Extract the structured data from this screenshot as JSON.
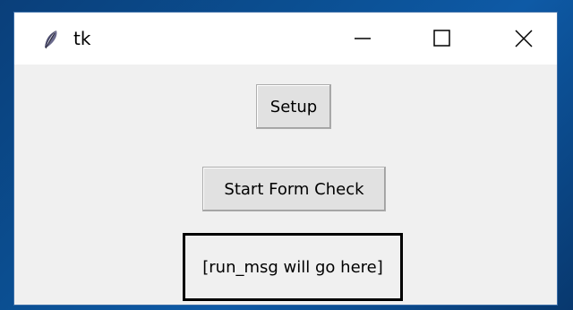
{
  "window": {
    "title": "tk",
    "app_icon": "feather-icon",
    "controls": {
      "minimize_icon": "minimize-icon",
      "maximize_icon": "maximize-icon",
      "close_icon": "close-icon"
    }
  },
  "main": {
    "setup_button_label": "Setup",
    "start_button_label": "Start Form Check",
    "run_msg": "[run_msg will go here]"
  },
  "colors": {
    "desktop": "#0b4f92",
    "window_bg": "#f0f0f0",
    "titlebar_bg": "#ffffff",
    "button_bg": "#e1e1e1",
    "button_border": "#adadad",
    "message_border": "#000000"
  }
}
